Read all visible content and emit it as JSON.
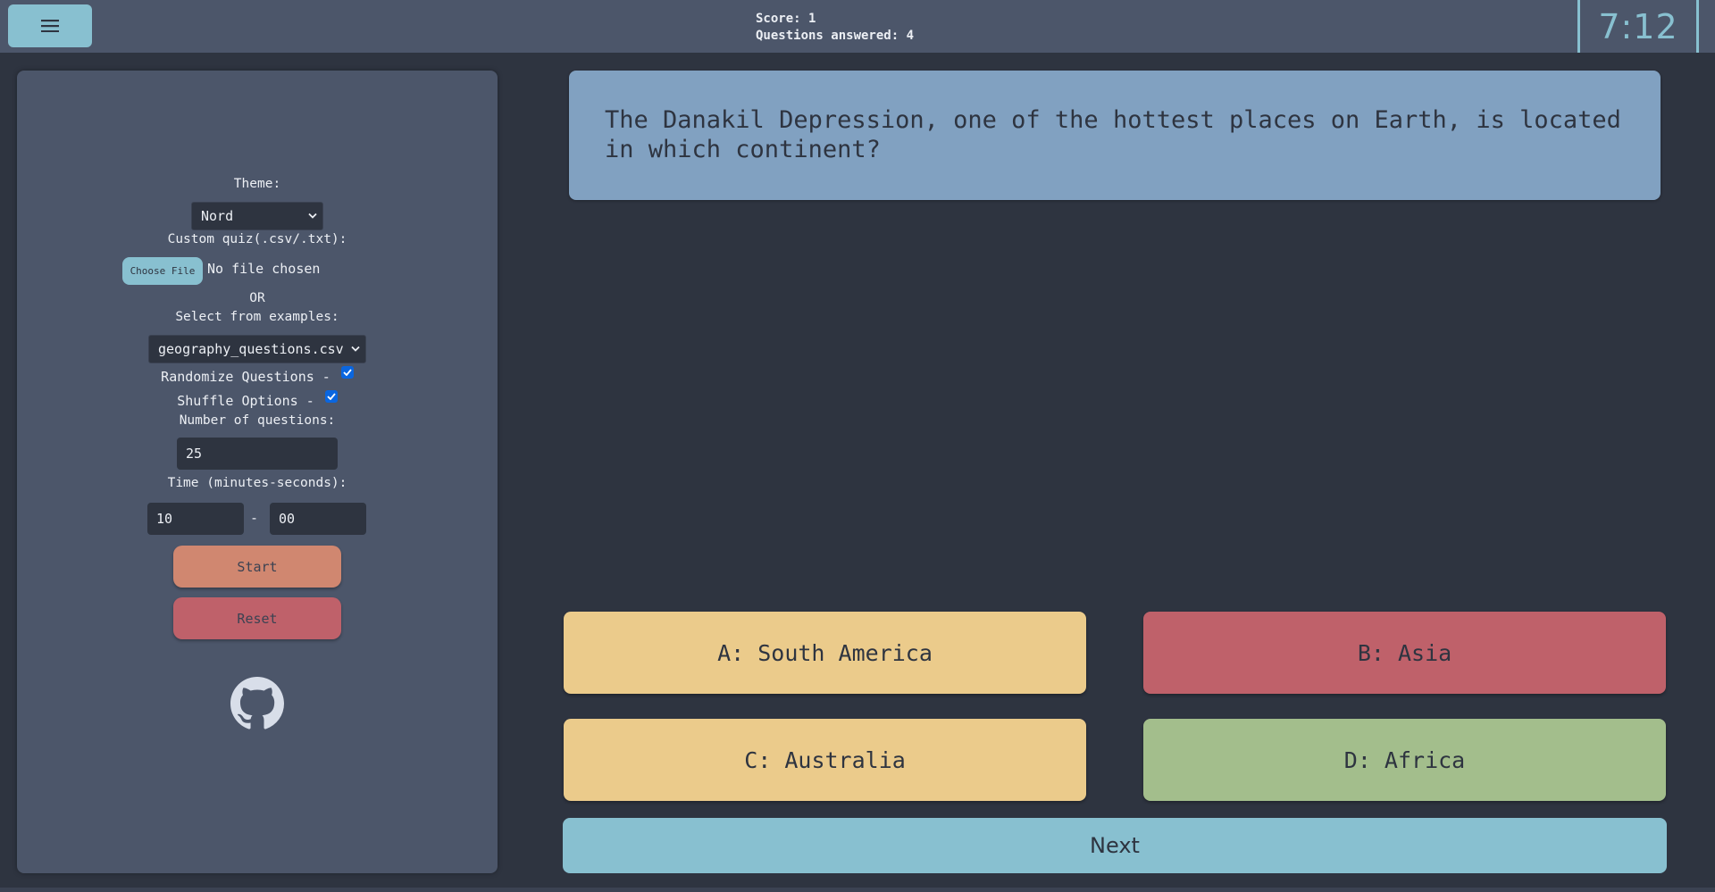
{
  "header": {
    "menu_icon": "hamburger-menu-icon",
    "score_text": "Score: 1",
    "answered_text": "Questions answered: 4",
    "timer": "7:12"
  },
  "sidebar": {
    "theme_label": "Theme:",
    "theme_value": "Nord",
    "custom_quiz_label": "Custom quiz(.csv/.txt):",
    "choose_file_label": "Choose File",
    "file_status": "No file chosen",
    "or_label": "OR",
    "examples_label": "Select from examples:",
    "examples_value": "geography_questions.csv",
    "randomize_label": "Randomize Questions -",
    "randomize_checked": true,
    "shuffle_label": "Shuffle Options -",
    "shuffle_checked": true,
    "num_questions_label": "Number of questions:",
    "num_questions_value": "25",
    "time_label": "Time (minutes-seconds):",
    "time_minutes": "10",
    "time_separator": "-",
    "time_seconds": "00",
    "start_label": "Start",
    "reset_label": "Reset",
    "github_icon": "github-icon"
  },
  "question": {
    "text": "The Danakil Depression, one of the hottest places on Earth, is located in which continent?"
  },
  "answers": [
    {
      "label": "A: South America",
      "color": "#ebcb8b"
    },
    {
      "label": "B: Asia",
      "color": "#bf616a"
    },
    {
      "label": "C: Australia",
      "color": "#ebcb8b"
    },
    {
      "label": "D: Africa",
      "color": "#a3be8c"
    }
  ],
  "next_label": "Next",
  "colors": {
    "background": "#2e3440",
    "panel": "#4c566a",
    "accent": "#88c0d0",
    "question_bg": "#81a1c1",
    "start": "#d08770",
    "reset": "#bf616a"
  }
}
